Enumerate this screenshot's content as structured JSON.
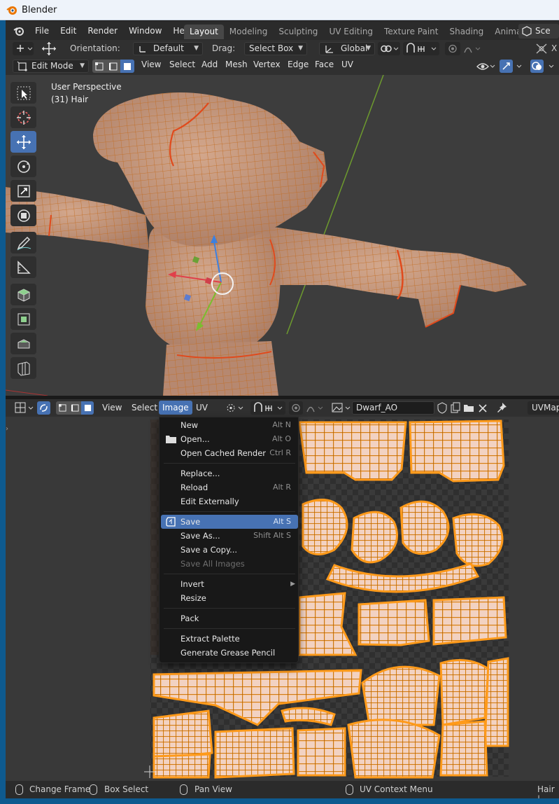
{
  "window": {
    "title": "Blender"
  },
  "topbar": {
    "menus": [
      "File",
      "Edit",
      "Render",
      "Window",
      "Help"
    ],
    "workspaces": [
      "Layout",
      "Modeling",
      "Sculpting",
      "UV Editing",
      "Texture Paint",
      "Shading",
      "Animation"
    ],
    "active_workspace": "Layout",
    "scene": "Sce"
  },
  "tool_settings": {
    "orientation_label": "Orientation:",
    "orientation_value": "Default",
    "drag_label": "Drag:",
    "drag_value": "Select Box",
    "transform_value": "Global",
    "close_x": "X"
  },
  "viewport_header": {
    "mode": "Edit Mode",
    "menus": [
      "View",
      "Select",
      "Add",
      "Mesh",
      "Vertex",
      "Edge",
      "Face",
      "UV"
    ]
  },
  "viewport": {
    "perspective": "User Perspective",
    "object_info": "(31) Hair"
  },
  "uv_header": {
    "menus": [
      "View",
      "Select",
      "Image",
      "UV"
    ],
    "active_menu": "Image",
    "image_name": "Dwarf_AO",
    "uvmap": "UVMap"
  },
  "image_menu": {
    "items": [
      {
        "label": "New",
        "shortcut": "Alt N"
      },
      {
        "label": "Open...",
        "shortcut": "Alt O"
      },
      {
        "label": "Open Cached Render",
        "shortcut": "Ctrl R"
      },
      {
        "label": "Replace...",
        "shortcut": ""
      },
      {
        "label": "Reload",
        "shortcut": "Alt R"
      },
      {
        "label": "Edit Externally",
        "shortcut": ""
      },
      {
        "label": "Save",
        "shortcut": "Alt S"
      },
      {
        "label": "Save As...",
        "shortcut": "Shift Alt S"
      },
      {
        "label": "Save a Copy...",
        "shortcut": ""
      },
      {
        "label": "Save All Images",
        "shortcut": ""
      },
      {
        "label": "Invert",
        "shortcut": ""
      },
      {
        "label": "Resize",
        "shortcut": ""
      },
      {
        "label": "Pack",
        "shortcut": ""
      },
      {
        "label": "Extract Palette",
        "shortcut": ""
      },
      {
        "label": "Generate Grease Pencil",
        "shortcut": ""
      }
    ],
    "highlighted": "Save"
  },
  "statusbar": {
    "left": "Change Frame",
    "middle": "Box Select",
    "pan": "Pan View",
    "context": "UV Context Menu",
    "right": "Hair |"
  },
  "colors": {
    "accent": "#4772b3",
    "uv_island": "#ff9a1a",
    "mesh_skin": "#c89a80",
    "viewport_bg": "#3d3d3d"
  }
}
